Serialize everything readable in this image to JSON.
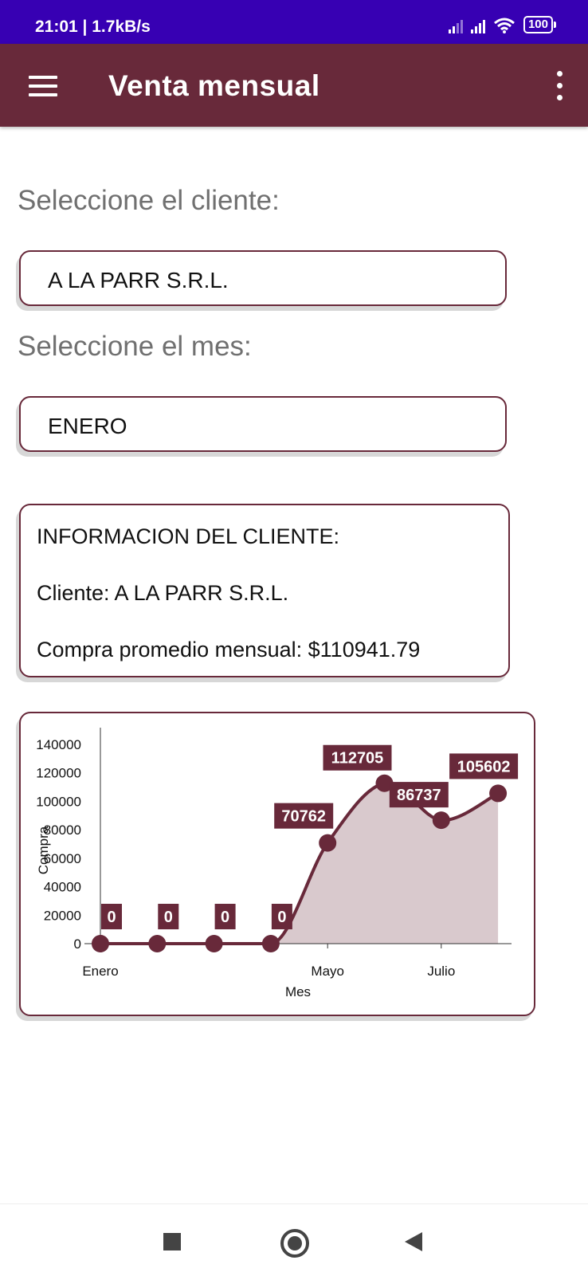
{
  "status_bar": {
    "time_speed": "21:01 | 1.7kB/s",
    "battery": "100"
  },
  "app_bar": {
    "title": "Venta mensual",
    "menu_icon": "hamburger-menu-icon",
    "more_icon": "more-vert-icon"
  },
  "client_select": {
    "label": "Seleccione el cliente:",
    "value": "A LA PARR S.R.L."
  },
  "month_select": {
    "label": "Seleccione el mes:",
    "value": "ENERO"
  },
  "info": {
    "heading": "INFORMACION DEL CLIENTE:",
    "client_line": "Cliente: A LA PARR S.R.L.",
    "average_line": "Compra promedio mensual: $110941.79"
  },
  "colors": {
    "status_bar": "#3700b3",
    "primary": "#68293a",
    "area_fill": "#d9c9cd"
  },
  "chart_data": {
    "type": "area",
    "xlabel": "Mes",
    "ylabel": "Compra",
    "x_tick_labels": [
      "Enero",
      "Mayo",
      "Julio"
    ],
    "x_tick_indices": [
      0,
      4,
      6
    ],
    "y_ticks": [
      0,
      20000,
      40000,
      60000,
      80000,
      100000,
      120000,
      140000
    ],
    "ylim": [
      0,
      140000
    ],
    "series": [
      {
        "values": [
          0,
          0,
          0,
          0,
          70762,
          112705,
          86737,
          105602
        ],
        "data_labels": [
          "0",
          "0",
          "0",
          "0",
          "70762",
          "112705",
          "86737",
          "105602"
        ]
      }
    ],
    "grid": false,
    "legend": "none"
  },
  "nav_bar": {
    "recents_icon": "square-recents-icon",
    "home_icon": "circle-home-icon",
    "back_icon": "triangle-back-icon"
  }
}
